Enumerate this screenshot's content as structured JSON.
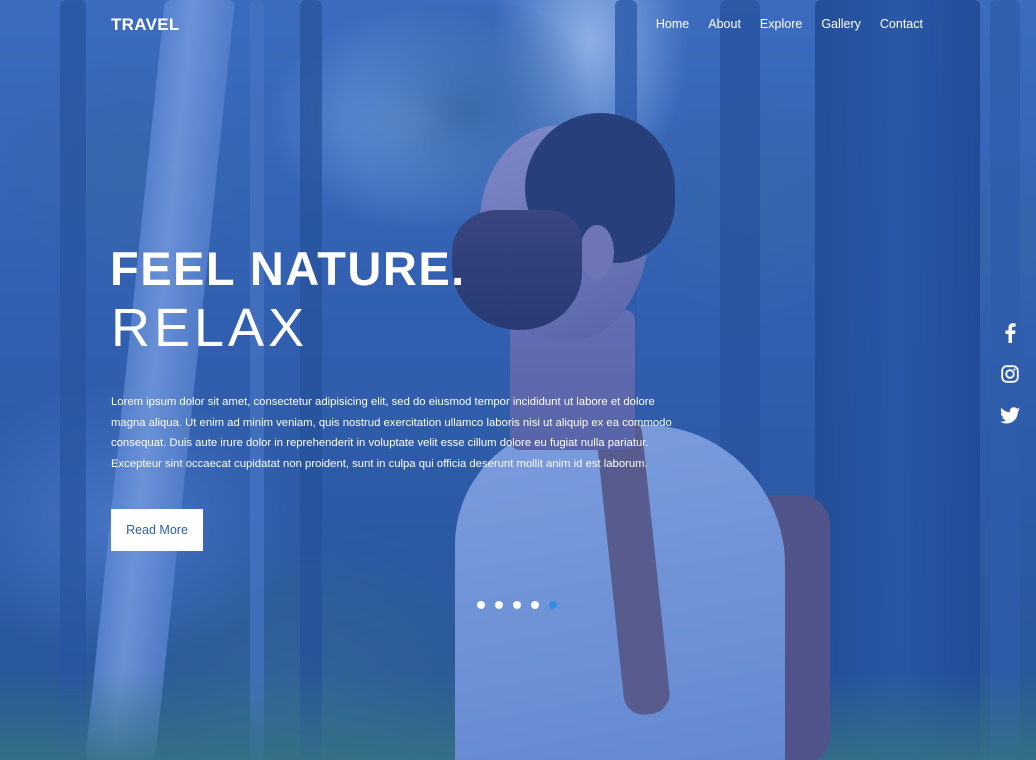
{
  "header": {
    "logo": "TRAVEL",
    "nav": [
      "Home",
      "About",
      "Explore",
      "Gallery",
      "Contact"
    ]
  },
  "hero": {
    "headline_line1": "FEEL NATURE.",
    "headline_line2": "RELAX",
    "description": "Lorem ipsum dolor sit amet, consectetur adipisicing elit, sed do eiusmod tempor incididunt ut labore et dolore magna aliqua. Ut enim ad minim veniam, quis nostrud exercitation ullamco laboris nisi ut aliquip ex ea commodo consequat. Duis aute irure dolor in reprehenderit in voluptate velit esse cillum dolore eu fugiat nulla pariatur. Excepteur sint occaecat cupidatat non proident, sunt in culpa qui officia deserunt mollit anim id est laborum.",
    "cta_label": "Read More"
  },
  "carousel": {
    "slide_count": 5,
    "active_index": 4,
    "active_color": "#2f8de4"
  },
  "social": {
    "icons": [
      "facebook-icon",
      "instagram-icon",
      "twitter-icon"
    ]
  },
  "colors": {
    "overlay": "#205ac8",
    "button_text": "#2a5ea8"
  }
}
